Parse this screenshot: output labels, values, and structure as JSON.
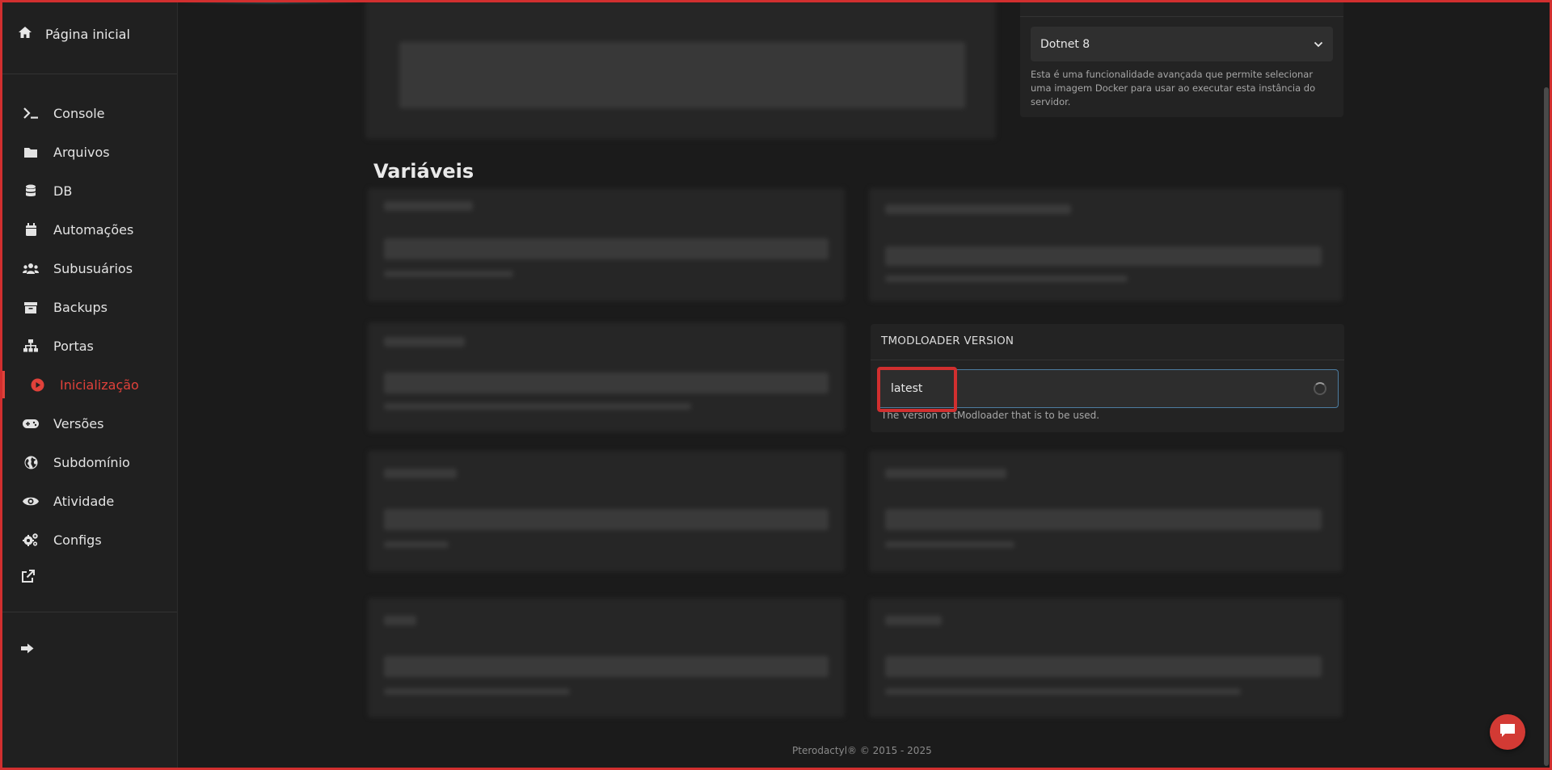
{
  "sidebar": {
    "home": {
      "label": "Página inicial",
      "icon": "home-icon"
    },
    "items": [
      {
        "label": "Console",
        "icon": "terminal-icon"
      },
      {
        "label": "Arquivos",
        "icon": "folder-icon"
      },
      {
        "label": "DB",
        "icon": "database-icon"
      },
      {
        "label": "Automações",
        "icon": "calendar-icon"
      },
      {
        "label": "Subusuários",
        "icon": "users-icon"
      },
      {
        "label": "Backups",
        "icon": "archive-icon"
      },
      {
        "label": "Portas",
        "icon": "network-icon"
      },
      {
        "label": "Inicialização",
        "icon": "play-circle-icon",
        "active": true
      },
      {
        "label": "Versões",
        "icon": "gamepad-icon"
      },
      {
        "label": "Subdomínio",
        "icon": "globe-icon"
      },
      {
        "label": "Atividade",
        "icon": "eye-icon"
      },
      {
        "label": "Configs",
        "icon": "gears-icon"
      }
    ],
    "external_link_icon": "external-link-icon",
    "logout_icon": "sign-out-icon",
    "active_color": "#e0413a"
  },
  "docker": {
    "selected": "Dotnet 8",
    "description": "Esta é uma funcionalidade avançada que permite selecionar uma imagem Docker para usar ao executar esta instância do servidor."
  },
  "variables": {
    "title": "Variáveis",
    "tmodloader": {
      "header": "TMODLOADER VERSION",
      "value": "latest",
      "help": "The version of tModloader that is to be used."
    }
  },
  "footer": "Pterodactyl® © 2015 - 2025",
  "chat_icon": "chat-icon",
  "colors": {
    "accent": "#d12f2f",
    "input_border": "#4d7ca0"
  }
}
